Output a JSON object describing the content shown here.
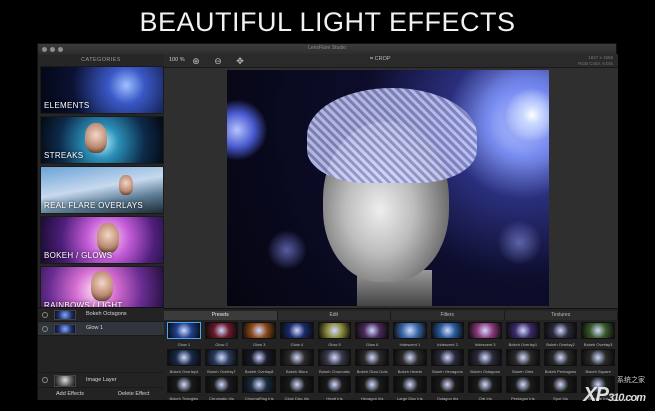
{
  "headline": "BEAUTIFUL LIGHT EFFECTS",
  "window": {
    "title": "LensFlare Studio"
  },
  "sidebar": {
    "header": "CATEGORIES",
    "categories": [
      {
        "label": "ELEMENTS"
      },
      {
        "label": "STREAKS"
      },
      {
        "label": "REAL FLARE OVERLAYS"
      },
      {
        "label": "BOKEH / GLOWS"
      },
      {
        "label": "RAINBOWS / LIGHT"
      }
    ]
  },
  "layers": {
    "items": [
      {
        "name": "Bokeh Octagons"
      },
      {
        "name": "Glow 1"
      }
    ],
    "image_layer": "Image Layer",
    "add_label": "Add Effects",
    "delete_label": "Delete Effect"
  },
  "toolbar": {
    "zoom": "100 %",
    "crop_label": "CROP",
    "info_line1": "1847 x 1568",
    "info_line2": "RGB Color, 8 bits"
  },
  "effects": {
    "tabs": [
      "Presets",
      "Edit",
      "Filters",
      "Textures"
    ],
    "active_tab": 0,
    "presets": [
      {
        "label": "Glow 1",
        "color": "#1f3f8a"
      },
      {
        "label": "Glow 2",
        "color": "#6a1a2a"
      },
      {
        "label": "Glow 3",
        "color": "#8a4a18"
      },
      {
        "label": "Glow 4",
        "color": "#1a2a6a"
      },
      {
        "label": "Glow 5",
        "color": "#8a8a3a"
      },
      {
        "label": "Glow 6",
        "color": "#4a2a5a"
      },
      {
        "label": "Iridescent 1",
        "color": "#3a6aa8"
      },
      {
        "label": "Iridescent 2",
        "color": "#2a5a9a"
      },
      {
        "label": "Iridescent 3",
        "color": "#8a3a7a"
      },
      {
        "label": "Bokeh Overlay1",
        "color": "#3a2a6a"
      },
      {
        "label": "Bokeh Overlay2",
        "color": "#2a2a3a"
      },
      {
        "label": "Bokeh Overlay3",
        "color": "#3a5a2a"
      },
      {
        "label": "Bokeh Overlay4",
        "color": "#1a2a4a"
      },
      {
        "label": "Bokeh Overlay7",
        "color": "#2a3a5a"
      },
      {
        "label": "Bokeh Overlay8",
        "color": "#1a1a2a"
      },
      {
        "label": "Bokeh Blurs",
        "color": "#2a2a2a"
      },
      {
        "label": "Bokeh Chromatic",
        "color": "#3a3a4a"
      },
      {
        "label": "Bokeh Glow Dots",
        "color": "#2a2a2a"
      },
      {
        "label": "Bokeh Hearts",
        "color": "#2a2a2a"
      },
      {
        "label": "Bokeh Hexagons",
        "color": "#2a2a3a"
      },
      {
        "label": "Bokeh Octagons",
        "color": "#2a2a3a"
      },
      {
        "label": "Bokeh Orbs",
        "color": "#2a2a2a"
      },
      {
        "label": "Bokeh Pentagons",
        "color": "#2a2a2a"
      },
      {
        "label": "Bokeh Square",
        "color": "#2a2a2a"
      },
      {
        "label": "Bokeh Triangles",
        "color": "#1a1a1a"
      },
      {
        "label": "Chromatic Iris",
        "color": "#1a1a1a"
      },
      {
        "label": "ChromaRing Iris",
        "color": "#1a2a3a"
      },
      {
        "label": "Glow Disc Iris",
        "color": "#1a1a1a"
      },
      {
        "label": "Heart Iris",
        "color": "#1a1a1a"
      },
      {
        "label": "Hexagon Iris",
        "color": "#1a1a1a"
      },
      {
        "label": "Large Disc Iris",
        "color": "#1a1a1a"
      },
      {
        "label": "Octagon Iris",
        "color": "#1a1a1a"
      },
      {
        "label": "Orb Iris",
        "color": "#1a1a1a"
      },
      {
        "label": "Pentagon Iris",
        "color": "#1a1a1a"
      },
      {
        "label": "Spot Iris",
        "color": "#1a1a1a"
      },
      {
        "label": "Triangle Iris",
        "color": "#1a1a1a"
      }
    ],
    "selected_index": 0
  },
  "watermark": {
    "main": "XP",
    "suffix": "310.com",
    "cn": "系统之家"
  }
}
